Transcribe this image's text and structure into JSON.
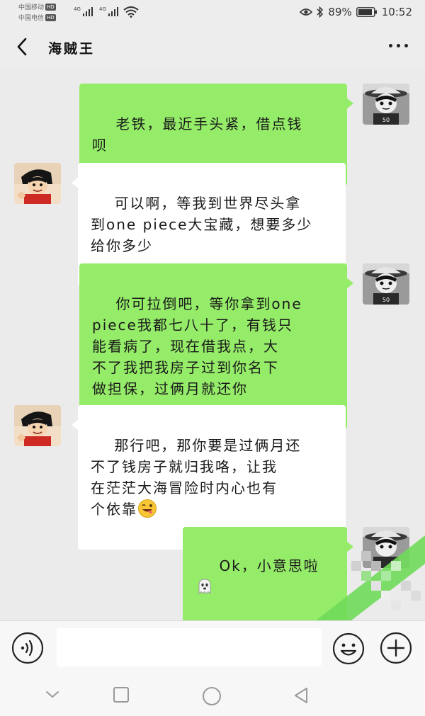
{
  "status_bar": {
    "carrier1": "中国移动",
    "carrier2": "中国电信",
    "hd_label": "HD",
    "network": "4G",
    "battery_percent": "89%",
    "time": "10:52"
  },
  "header": {
    "title": "海贼王",
    "back_icon": "chevron-left-icon",
    "more_icon": "more-dots-icon"
  },
  "messages": [
    {
      "sender": "self",
      "text": "老铁，最近手头紧，借点钱\n呗"
    },
    {
      "sender": "other",
      "text": "可以啊，等我到世界尽头拿\n到one piece大宝藏，想要多少\n给你多少"
    },
    {
      "sender": "self",
      "text": "你可拉倒吧，等你拿到one\npiece我都七八十了，有钱只\n能看病了，现在借我点，大\n不了我把我房子过到你名下\n做担保，过俩月就还你"
    },
    {
      "sender": "other",
      "text": "那行吧，那你要是过俩月还\n不了钱房子就归我咯，让我\n在茫茫大海冒险时内心也有\n个依靠",
      "emoji": "grinning-tongue-emoji"
    },
    {
      "sender": "self",
      "text": "Ok，小意思啦",
      "emoji": "ghost-emoji"
    }
  ],
  "input_bar": {
    "voice_icon": "voice-icon",
    "input_value": "",
    "emoji_icon": "smiley-icon",
    "plus_icon": "plus-icon"
  },
  "system_nav": {
    "icons": [
      "chevron-down-icon",
      "square-icon",
      "circle-icon",
      "triangle-back-icon"
    ]
  },
  "colors": {
    "self_bubble": "#95ec69",
    "other_bubble": "#ffffff",
    "chat_background": "#ebebeb"
  }
}
